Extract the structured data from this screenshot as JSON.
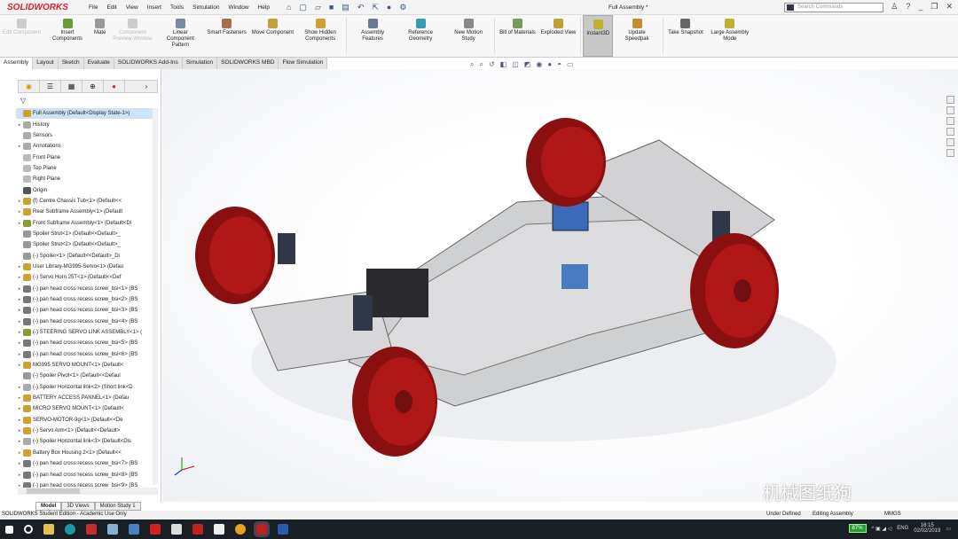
{
  "app": {
    "logo": "SOLIDWORKS",
    "doc_title": "Full Assembly *",
    "search_placeholder": "Search Commands"
  },
  "menu": [
    "File",
    "Edit",
    "View",
    "Insert",
    "Tools",
    "Simulation",
    "Window",
    "Help"
  ],
  "ribbon": [
    {
      "label": "Edit Component",
      "disabled": true,
      "color": "#ccc"
    },
    {
      "label": "Insert Components",
      "color": "#6a9d3a"
    },
    {
      "label": "Mate",
      "color": "#999"
    },
    {
      "label": "Component Preview Window",
      "disabled": true,
      "color": "#ccc"
    },
    {
      "label": "Linear Component Pattern",
      "color": "#7a8aa0"
    },
    {
      "label": "Smart Fasteners",
      "color": "#a07050"
    },
    {
      "label": "Move Component",
      "color": "#c0a040"
    },
    {
      "label": "Show Hidden Components",
      "color": "#d0a030"
    },
    {
      "label": "Assembly Features",
      "color": "#6a7a90"
    },
    {
      "label": "Reference Geometry",
      "color": "#3a9ab0"
    },
    {
      "label": "New Motion Study",
      "color": "#888"
    },
    {
      "label": "Bill of Materials",
      "color": "#7a9a5a"
    },
    {
      "label": "Exploded View",
      "color": "#c0a030"
    },
    {
      "label": "Instant3D",
      "active": true,
      "color": "#c0b030"
    },
    {
      "label": "Update Speedpak",
      "color": "#c09030"
    },
    {
      "label": "Take Snapshot",
      "color": "#666"
    },
    {
      "label": "Large Assembly Mode",
      "color": "#c0b030"
    }
  ],
  "tabs": [
    "Assembly",
    "Layout",
    "Sketch",
    "Evaluate",
    "SOLIDWORKS Add-Ins",
    "Simulation",
    "SOLIDWORKS MBD",
    "Flow Simulation"
  ],
  "tree": [
    {
      "label": "Full Assembly  (Default<Display State-1>)",
      "selected": true,
      "icon": "#d0a030"
    },
    {
      "label": "History",
      "expand": true,
      "icon": "#aaa"
    },
    {
      "label": "Sensors",
      "icon": "#aaa"
    },
    {
      "label": "Annotations",
      "expand": true,
      "icon": "#aaa"
    },
    {
      "label": "Front Plane",
      "icon": "#bbb"
    },
    {
      "label": "Top Plane",
      "icon": "#bbb"
    },
    {
      "label": "Right Plane",
      "icon": "#bbb"
    },
    {
      "label": "Origin",
      "icon": "#555"
    },
    {
      "label": "(f) Centre Chassis Tub<1> (Default<<",
      "expand": true,
      "icon": "#d0a030"
    },
    {
      "label": "Rear Subframe Assembly<1> (Default",
      "expand": true,
      "icon": "#d0a030"
    },
    {
      "label": "Front Subframe Assembly<1> (Default<Di",
      "expand": true,
      "icon": "#8a9a30"
    },
    {
      "label": "Spoiler Strut<1> (Default<<Default>_",
      "icon": "#999"
    },
    {
      "label": "Spoiler Strut<2> (Default<<Default>_",
      "icon": "#999"
    },
    {
      "label": "(-) Spoiler<1> (Default<<Default>_Di",
      "icon": "#999"
    },
    {
      "label": "User Library-MG995-Servo<1> (Defau",
      "expand": true,
      "icon": "#d0a030"
    },
    {
      "label": "(-) Servo Horn 25T<1> (Default<<Def",
      "expand": true,
      "icon": "#d0a030"
    },
    {
      "label": "(-) pan head cross recess screw_bsi<1> (BS",
      "expand": true,
      "icon": "#777"
    },
    {
      "label": "(-) pan head cross recess screw_bsi<2> (BS",
      "expand": true,
      "icon": "#777"
    },
    {
      "label": "(-) pan head cross recess screw_bsi<3> (BS",
      "expand": true,
      "icon": "#777"
    },
    {
      "label": "(-) pan head cross recess screw_bsi<4> (BS",
      "expand": true,
      "icon": "#777"
    },
    {
      "label": "(-) STEERING SERVO LINK ASSEMBLY<1> (",
      "expand": true,
      "icon": "#8a9a30"
    },
    {
      "label": "(-) pan head cross recess screw_bsi<5> (BS",
      "expand": true,
      "icon": "#777"
    },
    {
      "label": "(-) pan head cross recess screw_bsi<6> (BS",
      "expand": true,
      "icon": "#777"
    },
    {
      "label": "MG995 SERVO MOUNT<1> (Default<",
      "expand": true,
      "icon": "#d0a030"
    },
    {
      "label": "(-) Spoiler Pivot<1> (Default<<Defaul",
      "icon": "#999"
    },
    {
      "label": "(-) Spoiler Horizontal link<2> (Short link<D",
      "expand": true,
      "icon": "#aaa"
    },
    {
      "label": "BATTERY ACCESS PANNEL<1> (Defau",
      "expand": true,
      "icon": "#d0a030"
    },
    {
      "label": "MICRO SERVO MOUNT<1> (Default<",
      "expand": true,
      "icon": "#d0a030"
    },
    {
      "label": "SERVO-MOTOR-9g<1> (Default<<De",
      "expand": true,
      "icon": "#d0a030"
    },
    {
      "label": "(-) Servo Arm<1> (Default<<Default>",
      "expand": true,
      "icon": "#d0a030"
    },
    {
      "label": "(-) Spoiler Horizontal link<3> (Default<Dis",
      "expand": true,
      "icon": "#aaa"
    },
    {
      "label": "Battery Box Housing 2<1> (Default<<",
      "expand": true,
      "icon": "#d0a030"
    },
    {
      "label": "(-) pan head cross recess screw_bsi<7> (BS",
      "expand": true,
      "icon": "#777"
    },
    {
      "label": "(-) pan head cross recess screw_bsi<8> (BS",
      "expand": true,
      "icon": "#777"
    },
    {
      "label": "(-) pan head cross recess screw_bsi<9> (BS",
      "expand": true,
      "icon": "#777"
    }
  ],
  "bottom_tabs": [
    "Model",
    "3D Views",
    "Motion Study 1"
  ],
  "status": {
    "edition": "SOLIDWORKS Student Edition - Academic Use Only",
    "state": "Under Defined",
    "mode": "Editing Assembly",
    "units": "MMGS"
  },
  "taskbar": {
    "battery": "87%",
    "lang": "ENG",
    "time": "16:15",
    "date": "02/02/2019"
  },
  "watermark": "机械图纸狗"
}
